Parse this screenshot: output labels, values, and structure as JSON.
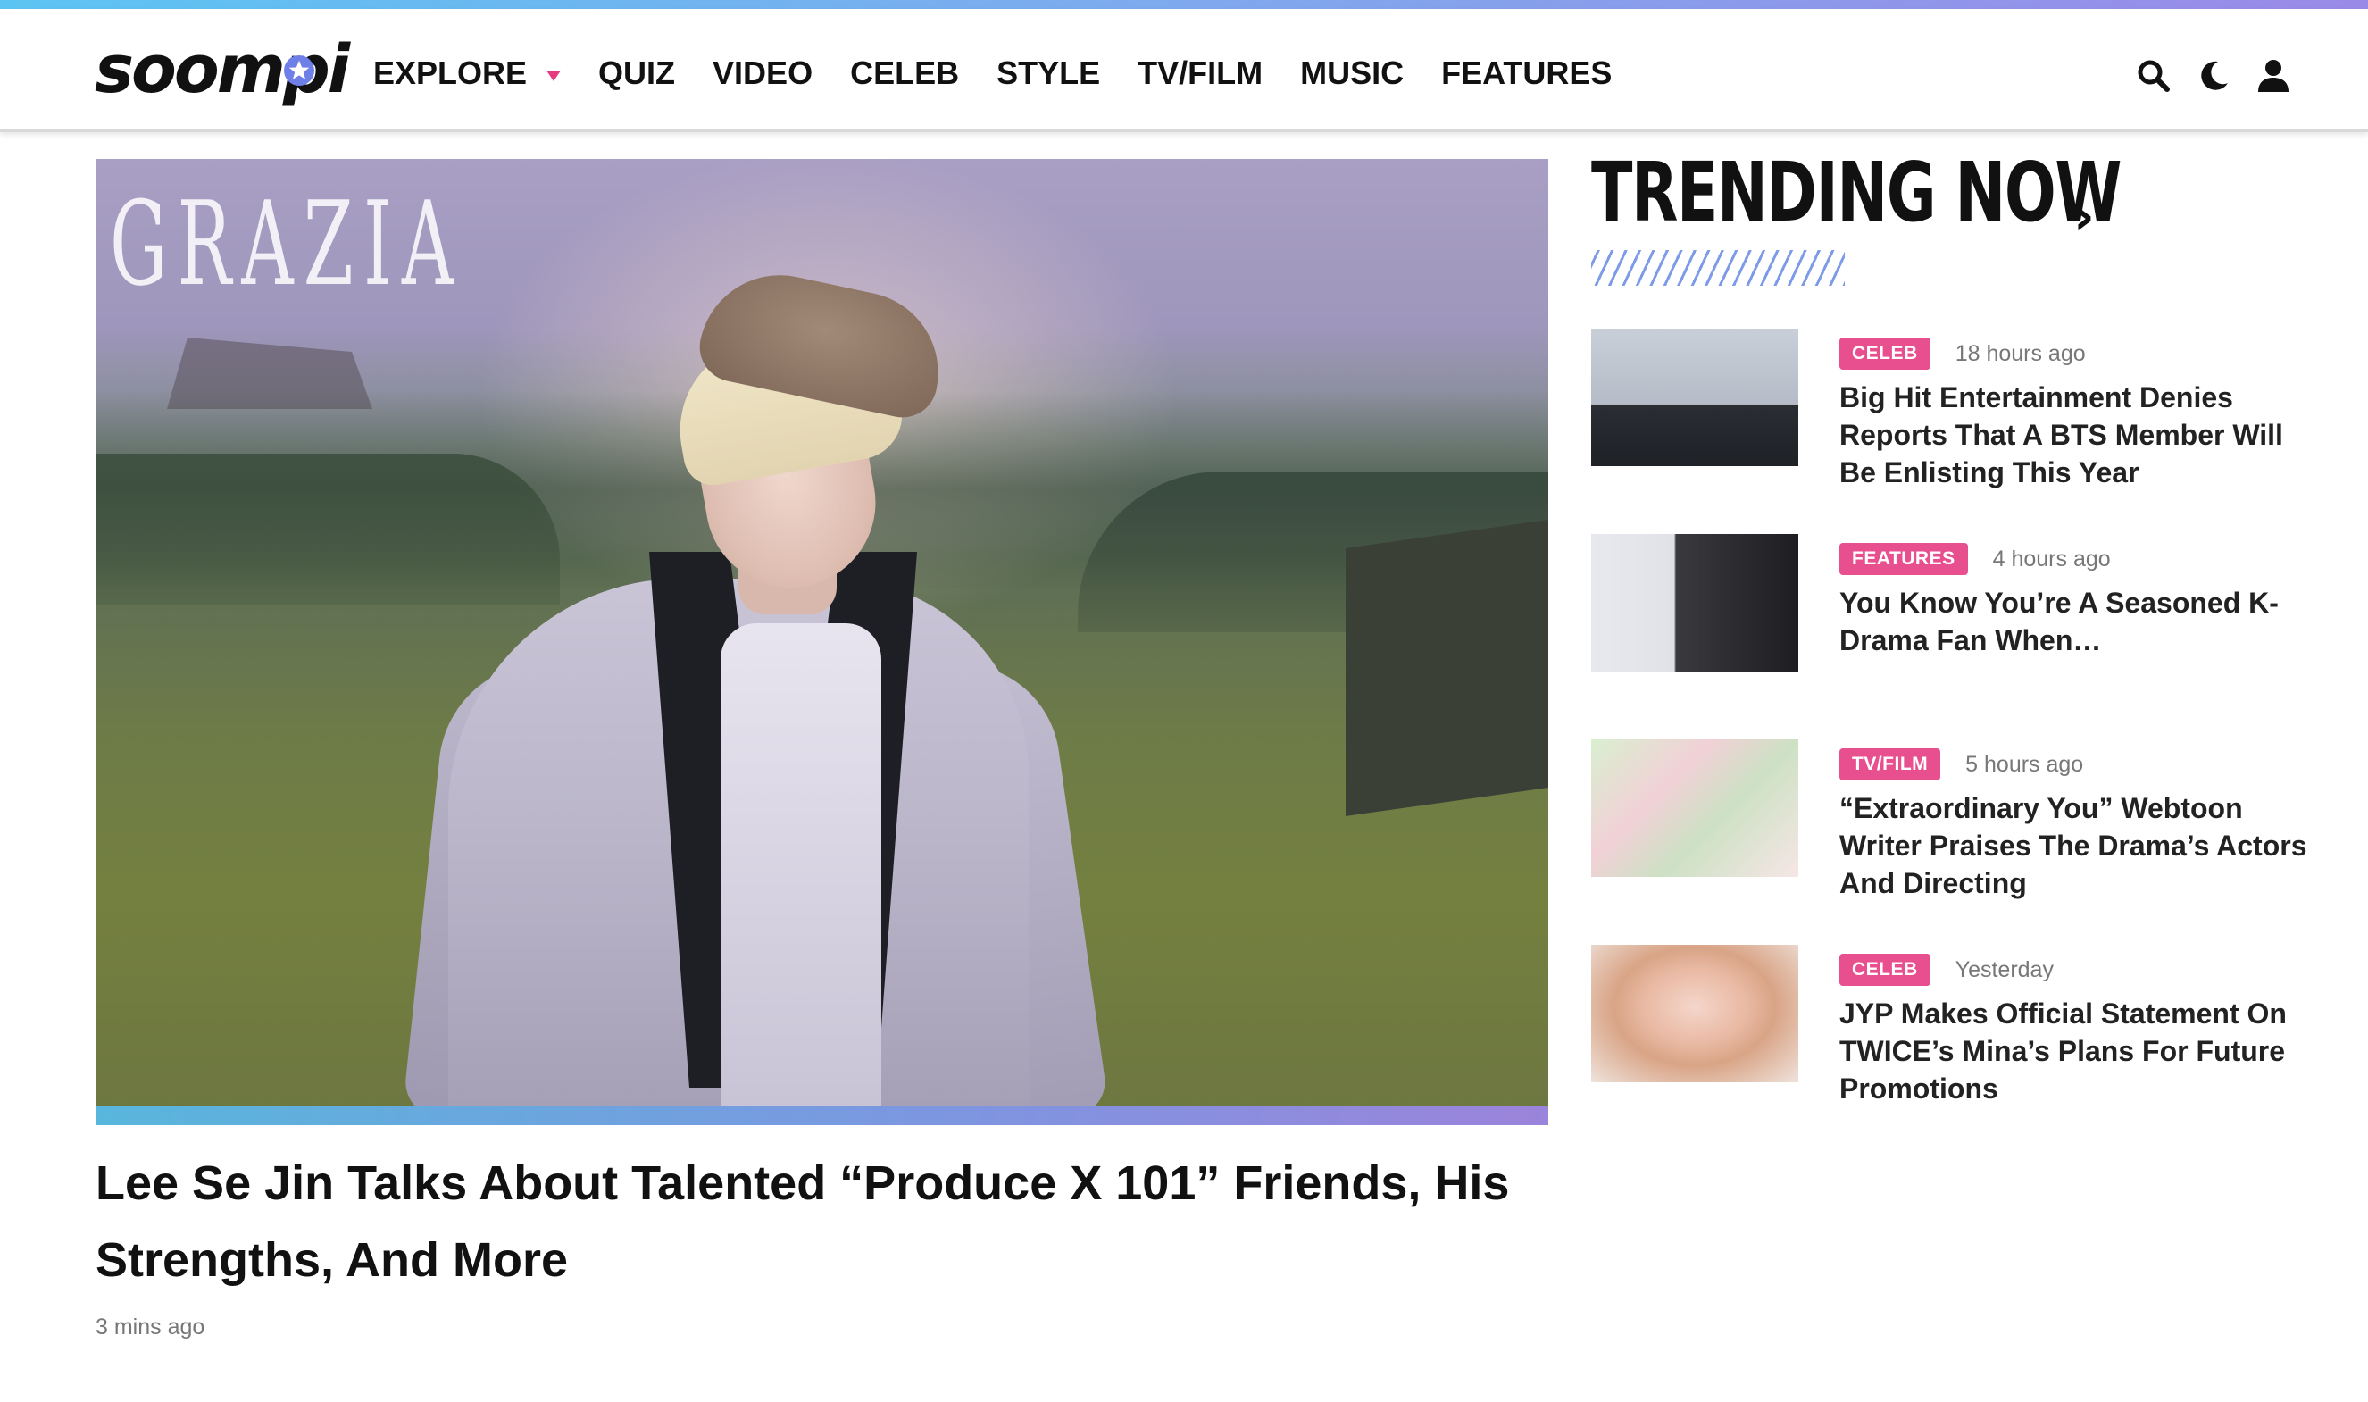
{
  "brand": {
    "name": "soompi",
    "accent": "#e84f8f",
    "gradient": [
      "#5cc4f2",
      "#9a8ae8"
    ]
  },
  "nav": {
    "items": [
      {
        "label": "EXPLORE",
        "has_dropdown": true
      },
      {
        "label": "QUIZ"
      },
      {
        "label": "VIDEO"
      },
      {
        "label": "CELEB"
      },
      {
        "label": "STYLE"
      },
      {
        "label": "TV/FILM"
      },
      {
        "label": "MUSIC"
      },
      {
        "label": "FEATURES"
      }
    ],
    "icons": [
      "search-icon",
      "moon-icon",
      "user-icon"
    ]
  },
  "hero": {
    "image_caption": "GRAZIA",
    "title": "Lee Se Jin Talks About Talented “Produce X 101” Friends, His Strengths, And More",
    "time": "3 mins ago"
  },
  "trending": {
    "title": "TRENDING NOW",
    "arrow": "›",
    "items": [
      {
        "category": "CELEB",
        "time": "18 hours ago",
        "headline": "Big Hit Entertainment Denies Reports That A BTS Member Will Be Enlisting This Year"
      },
      {
        "category": "FEATURES",
        "time": "4 hours ago",
        "headline": "You Know You’re A Seasoned K-Drama Fan When…"
      },
      {
        "category": "TV/FILM",
        "time": "5 hours ago",
        "headline": "“Extraordinary You” Webtoon Writer Praises The Drama’s Actors And Directing"
      },
      {
        "category": "CELEB",
        "time": "Yesterday",
        "headline": "JYP Makes Official Statement On TWICE’s Mina’s Plans For Future Promotions"
      }
    ]
  }
}
